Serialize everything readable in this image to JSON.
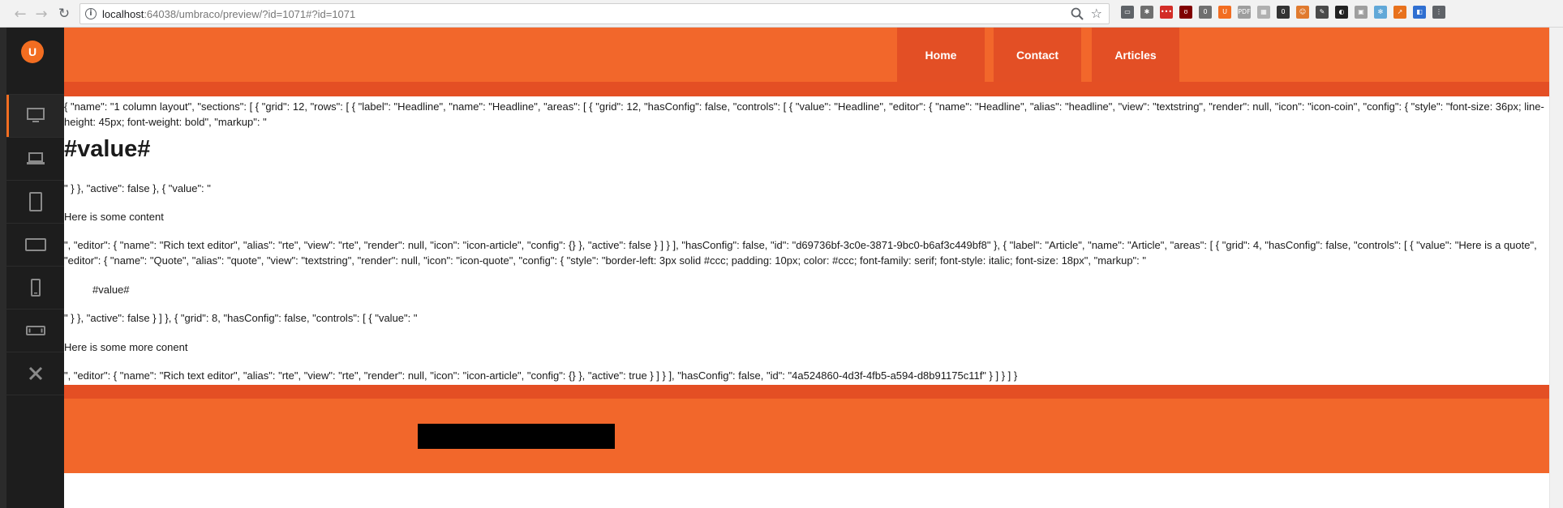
{
  "browser": {
    "back_glyph": "←",
    "forward_glyph": "→",
    "reload_glyph": "↻",
    "info_glyph": "i",
    "url_host": "localhost",
    "url_rest": ":64038/umbraco/preview/?id=1071#?id=1071",
    "star_glyph": "☆",
    "extensions": [
      {
        "name": "cast-icon",
        "color": "#5f6368",
        "label": "▭"
      },
      {
        "name": "bug-icon",
        "color": "#6f6f6f",
        "label": "✱"
      },
      {
        "name": "lastpass-icon",
        "color": "#d32d27",
        "label": "•••"
      },
      {
        "name": "ublock-icon",
        "color": "#800000",
        "label": "ʊ"
      },
      {
        "name": "shield-icon",
        "color": "#6f6f6f",
        "label": "0"
      },
      {
        "name": "umbraco-ext-icon",
        "color": "#f26d21",
        "label": "U"
      },
      {
        "name": "pdf-icon",
        "color": "#9e9e9e",
        "label": "PDF"
      },
      {
        "name": "grid-icon",
        "color": "#b0b0b0",
        "label": "▦"
      },
      {
        "name": "ghost-icon",
        "color": "#333333",
        "label": "0"
      },
      {
        "name": "face-icon",
        "color": "#e07a2e",
        "label": "☺"
      },
      {
        "name": "tools-icon",
        "color": "#4a4a4a",
        "label": "✎"
      },
      {
        "name": "mask-icon",
        "color": "#222222",
        "label": "◐"
      },
      {
        "name": "owl-icon",
        "color": "#9e9e9e",
        "label": "▣"
      },
      {
        "name": "react-icon",
        "color": "#61a8d8",
        "label": "✻"
      },
      {
        "name": "chart-icon",
        "color": "#e8711c",
        "label": "↗"
      },
      {
        "name": "doc-icon",
        "color": "#2f6fd1",
        "label": "◧"
      },
      {
        "name": "menu-icon",
        "color": "#5f6368",
        "label": "⋮"
      }
    ]
  },
  "sidebar": {
    "logo_glyph": "U",
    "devices": [
      {
        "name": "desktop-icon",
        "active": true
      },
      {
        "name": "laptop-icon",
        "active": false
      },
      {
        "name": "tablet-portrait-icon",
        "active": false
      },
      {
        "name": "tablet-landscape-icon",
        "active": false
      },
      {
        "name": "smartphone-portrait-icon",
        "active": false
      },
      {
        "name": "smartphone-landscape-icon",
        "active": false
      },
      {
        "name": "close-icon",
        "active": false
      }
    ]
  },
  "site": {
    "nav": {
      "home": "Home",
      "contact": "Contact",
      "articles": "Articles"
    },
    "content": {
      "json_1": "{ \"name\": \"1 column layout\", \"sections\": [ { \"grid\": 12, \"rows\": [ { \"label\": \"Headline\", \"name\": \"Headline\", \"areas\": [ { \"grid\": 12, \"hasConfig\": false, \"controls\": [ { \"value\": \"Headline\", \"editor\": { \"name\": \"Headline\", \"alias\": \"headline\", \"view\": \"textstring\", \"render\": null, \"icon\": \"icon-coin\", \"config\": { \"style\": \"font-size: 36px; line-height: 45px; font-weight: bold\", \"markup\": \"",
      "heading": "#value#",
      "json_2": "\" } }, \"active\": false }, { \"value\": \"",
      "para_1": "Here is some content",
      "json_3": "\", \"editor\": { \"name\": \"Rich text editor\", \"alias\": \"rte\", \"view\": \"rte\", \"render\": null, \"icon\": \"icon-article\", \"config\": {} }, \"active\": false } ] } ], \"hasConfig\": false, \"id\": \"d69736bf-3c0e-3871-9bc0-b6af3c449bf8\" }, { \"label\": \"Article\", \"name\": \"Article\", \"areas\": [ { \"grid\": 4, \"hasConfig\": false, \"controls\": [ { \"value\": \"Here is a quote\", \"editor\": { \"name\": \"Quote\", \"alias\": \"quote\", \"view\": \"textstring\", \"render\": null, \"icon\": \"icon-quote\", \"config\": { \"style\": \"border-left: 3px solid #ccc; padding: 10px; color: #ccc; font-family: serif; font-style: italic; font-size: 18px\", \"markup\": \"",
      "quote": "#value#",
      "json_4": "\" } }, \"active\": false } ] }, { \"grid\": 8, \"hasConfig\": false, \"controls\": [ { \"value\": \"",
      "para_2": "Here is some more conent",
      "json_5": "\", \"editor\": { \"name\": \"Rich text editor\", \"alias\": \"rte\", \"view\": \"rte\", \"render\": null, \"icon\": \"icon-article\", \"config\": {} }, \"active\": true } ] } ], \"hasConfig\": false, \"id\": \"4a524860-4d3f-4fb5-a594-d8b91175c11f\" } ] } ] }"
    }
  },
  "colors": {
    "brand_orange": "#f2672b",
    "dark_orange": "#e44f24",
    "sidebar_bg": "#1d1d1d"
  }
}
